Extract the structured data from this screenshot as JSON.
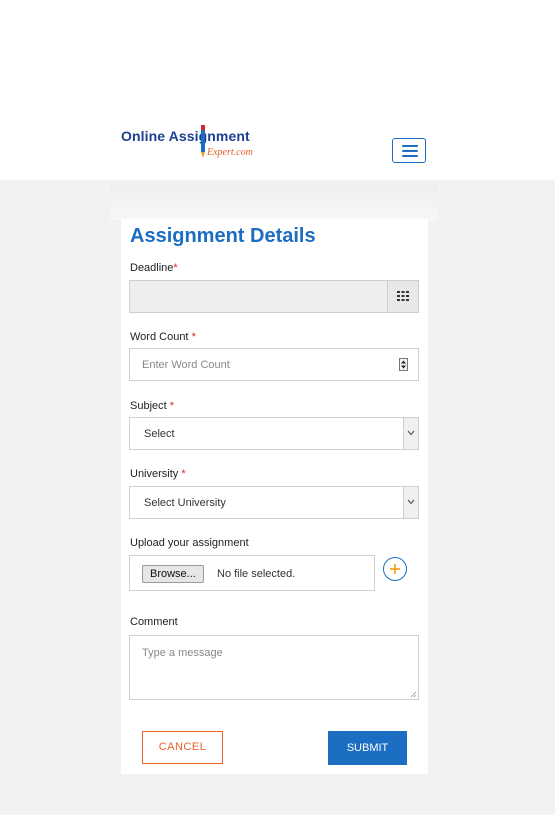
{
  "header": {
    "logo": {
      "line1": "Online Assignment",
      "line2": "Expert.com"
    }
  },
  "form": {
    "title": "Assignment Details",
    "deadline": {
      "label": "Deadline",
      "required_mark": "*",
      "value": ""
    },
    "word_count": {
      "label": "Word Count",
      "required_mark": "*",
      "placeholder": "Enter Word Count"
    },
    "subject": {
      "label": "Subject",
      "required_mark": "*",
      "selected": "Select"
    },
    "university": {
      "label": "University",
      "required_mark": "*",
      "selected": "Select University"
    },
    "upload": {
      "label": "Upload your assignment",
      "browse_label": "Browse...",
      "status": "No file selected."
    },
    "comment": {
      "label": "Comment",
      "placeholder": "Type a message"
    },
    "actions": {
      "cancel_label": "CANCEL",
      "submit_label": "SUBMIT"
    }
  },
  "colors": {
    "brand_blue": "#1b6ec2",
    "logo_navy": "#1c3f91",
    "accent_orange": "#e8602a",
    "required_red": "#e02020",
    "page_gray": "#f2f2f2"
  },
  "icons": {
    "menu": "hamburger-menu-icon",
    "calendar": "calendar-icon",
    "spinner": "number-spinner-icon",
    "dropdown": "chevron-down-icon",
    "add": "plus-icon",
    "resize": "resize-grip-icon"
  }
}
